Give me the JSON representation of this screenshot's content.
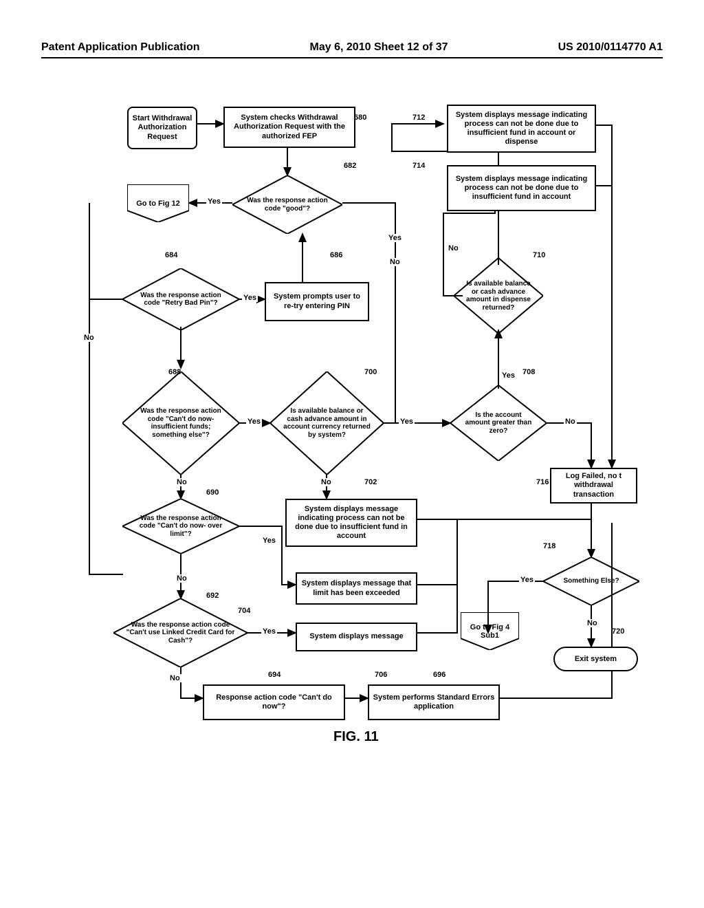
{
  "header": {
    "left": "Patent Application Publication",
    "center": "May 6, 2010  Sheet 12 of 37",
    "right": "US 2010/0114770 A1"
  },
  "figure_label": "FIG. 11",
  "nodes": {
    "start": "Start Withdrawal Authorization Request",
    "n680": "System checks Withdrawal Authorization Request with the authorized FEP",
    "n682": "Was the response action code \"good\"?",
    "goto12": "Go to Fig 12",
    "n684": "Was the response action code \"Retry Bad Pin\"?",
    "n686": "System prompts user to  re-try entering PIN",
    "n688": "Was the response action code \"Can't do now- insufficient funds; something else\"?",
    "n690": "Was the response action code \"Can't do now- over limit\"?",
    "n692": "Was the response action code \"Can't use Linked Credit Card for Cash\"?",
    "n694": "Response action code \"Can't do now\"?",
    "n696": "System performs Standard Errors application",
    "n700": "Is available balance or cash advance amount in account currency returned by system?",
    "n702": "System displays message indicating process can not be done due to insufficient fund in account",
    "n704": "System displays message that limit has been exceeded",
    "n706": "System displays message",
    "n708": "Is the account amount greater than zero?",
    "n710": "Is available balance or cash advance amount in dispense returned?",
    "n712": "System displays message indicating process can not be done due to insufficient fund in account or dispense",
    "n714": "System displays message indicating process can not be done due to insufficient fund in account",
    "n716": "Log Failed, no t withdrawal transaction",
    "n718": "Something Else?",
    "goto4": "Go to Fig 4 Sub1",
    "n720": "Exit system"
  },
  "ref_labels": {
    "r680": "680",
    "r682": "682",
    "r684": "684",
    "r686": "686",
    "r688": "688",
    "r690": "690",
    "r692": "692",
    "r694": "694",
    "r696": "696",
    "r700": "700",
    "r702": "702",
    "r704": "704",
    "r706": "706",
    "r708": "708",
    "r710": "710",
    "r712": "712",
    "r714": "714",
    "r716": "716",
    "r718": "718",
    "r720": "720"
  },
  "edge_labels": {
    "yes": "Yes",
    "no": "No"
  }
}
